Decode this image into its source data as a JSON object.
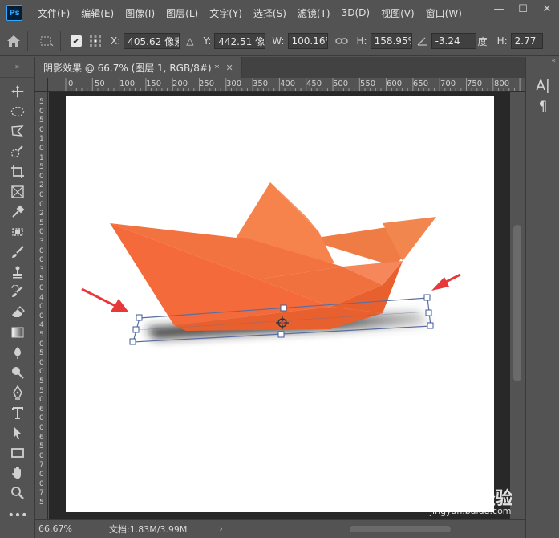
{
  "app": {
    "logo_text": "Ps",
    "menus": [
      "文件(F)",
      "编辑(E)",
      "图像(I)",
      "图层(L)",
      "文字(Y)",
      "选择(S)",
      "滤镜(T)",
      "3D(D)",
      "视图(V)",
      "窗口(W)"
    ],
    "window_controls": [
      "—",
      "☐",
      "✕"
    ]
  },
  "options": {
    "x_label": "X:",
    "x_value": "405.62 像素",
    "delta_label": "△",
    "y_label": "Y:",
    "y_value": "442.51 像素",
    "w_label": "W:",
    "w_value": "100.16%",
    "h_label": "H:",
    "h_value": "158.95%",
    "angle_value": "-3.24",
    "angle_unit": "度",
    "h2_label": "H:",
    "h2_value": "2.77"
  },
  "document": {
    "tab_title": "阴影效果 @ 66.7% (图层 1, RGB/8#) *",
    "tab_close": "✕"
  },
  "rulers": {
    "top": [
      "0",
      "50",
      "100",
      "150",
      "200",
      "250",
      "300",
      "350",
      "400",
      "450",
      "500",
      "550",
      "600",
      "650",
      "700",
      "750",
      "800"
    ],
    "left": [
      "5",
      "0",
      "5",
      "0",
      "1",
      "0",
      "1",
      "5",
      "0",
      "2",
      "0",
      "0",
      "2",
      "5",
      "0",
      "3",
      "0",
      "0",
      "3",
      "5",
      "0",
      "4",
      "0",
      "0",
      "4",
      "5",
      "0",
      "5",
      "0",
      "0",
      "5",
      "5",
      "0",
      "6",
      "0",
      "0",
      "6",
      "5",
      "0",
      "7",
      "0",
      "0",
      "7",
      "5"
    ]
  },
  "right_panel": {
    "text_tool_glyph": "A|",
    "paragraph_glyph": "¶"
  },
  "status": {
    "zoom": "66.67%",
    "doc_info": "文档:1.83M/3.99M",
    "arrow": "›"
  },
  "watermark": {
    "brand": "Baidu经验",
    "url": "jingyan.baidu.com"
  },
  "colors": {
    "boat_main": "#f46a3a",
    "boat_light": "#f7874f",
    "boat_dark": "#d9542a",
    "arrow_red": "#e8393a",
    "selection_line": "#5a6fa0"
  }
}
